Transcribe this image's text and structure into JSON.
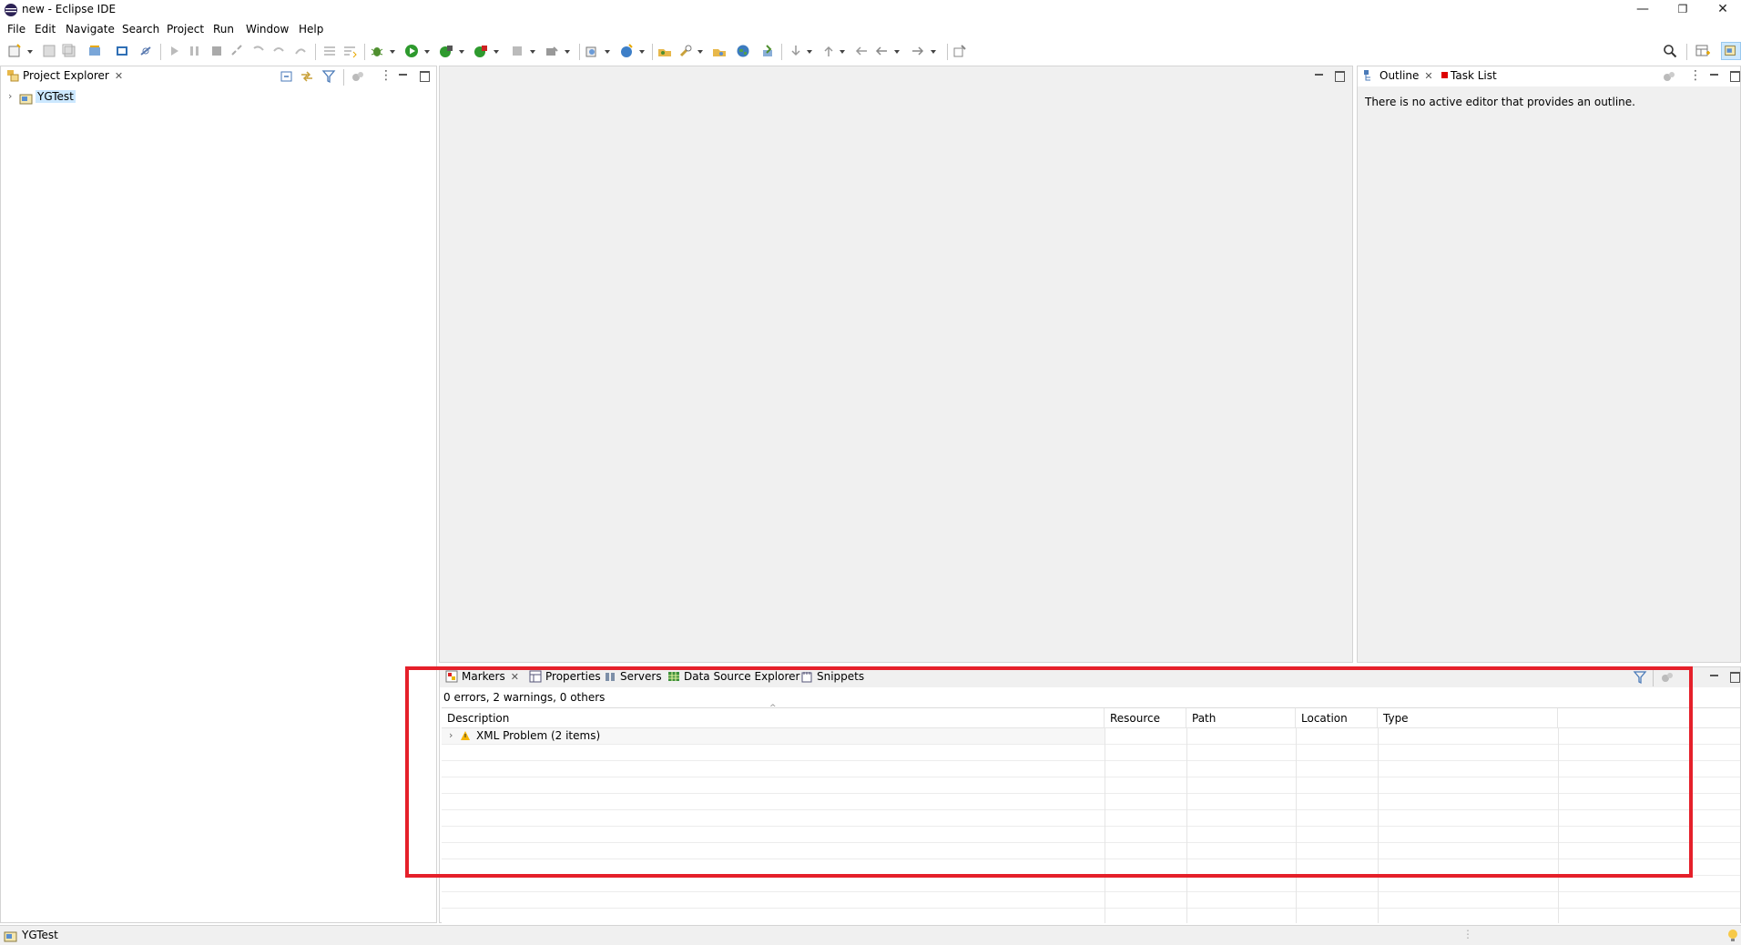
{
  "window": {
    "title": "new - Eclipse IDE",
    "minimize": "—",
    "restore": "❐",
    "close": "✕"
  },
  "menu": [
    "File",
    "Edit",
    "Navigate",
    "Search",
    "Project",
    "Run",
    "Window",
    "Help"
  ],
  "project_explorer": {
    "tab_label": "Project Explorer",
    "tree": [
      {
        "label": "YGTest",
        "expanded": false
      }
    ]
  },
  "outline": {
    "tab_label": "Outline",
    "second_tab": "Task List",
    "message": "There is no active editor that provides an outline."
  },
  "bottom": {
    "tabs": [
      "Markers",
      "Properties",
      "Servers",
      "Data Source Explorer",
      "Snippets"
    ],
    "summary": "0 errors, 2 warnings, 0 others",
    "columns": [
      "Description",
      "Resource",
      "Path",
      "Location",
      "Type"
    ],
    "rows": [
      {
        "description": "XML Problem (2 items)",
        "resource": "",
        "path": "",
        "location": "",
        "type": ""
      }
    ]
  },
  "status_bar": {
    "text": "YGTest"
  },
  "colors": {
    "accent_red": "#e5202a",
    "selection": "#cce8ff",
    "warning": "#f5b400"
  }
}
